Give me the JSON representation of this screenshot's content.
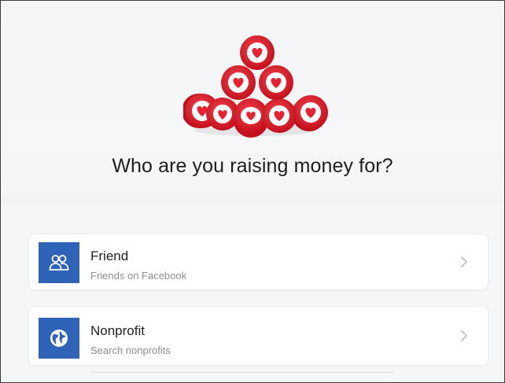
{
  "page": {
    "heading": "Who are you raising money for?"
  },
  "options": [
    {
      "title": "Friend",
      "subtitle": "Friends on Facebook",
      "icon": "people-icon",
      "chevron": "chevron-right-icon"
    },
    {
      "title": "Nonprofit",
      "subtitle": "Search nonprofits",
      "icon": "globe-icon",
      "chevron": "chevron-right-icon"
    }
  ],
  "colors": {
    "accent_blue": "#2e63b7",
    "heart_red": "#e8202f",
    "background": "#f2f3f5",
    "card": "#ffffff",
    "text_primary": "#1c1e21",
    "text_secondary": "#8a8d91"
  },
  "illustration": {
    "name": "heart-tokens-pyramid",
    "icon": "heart-icon"
  }
}
